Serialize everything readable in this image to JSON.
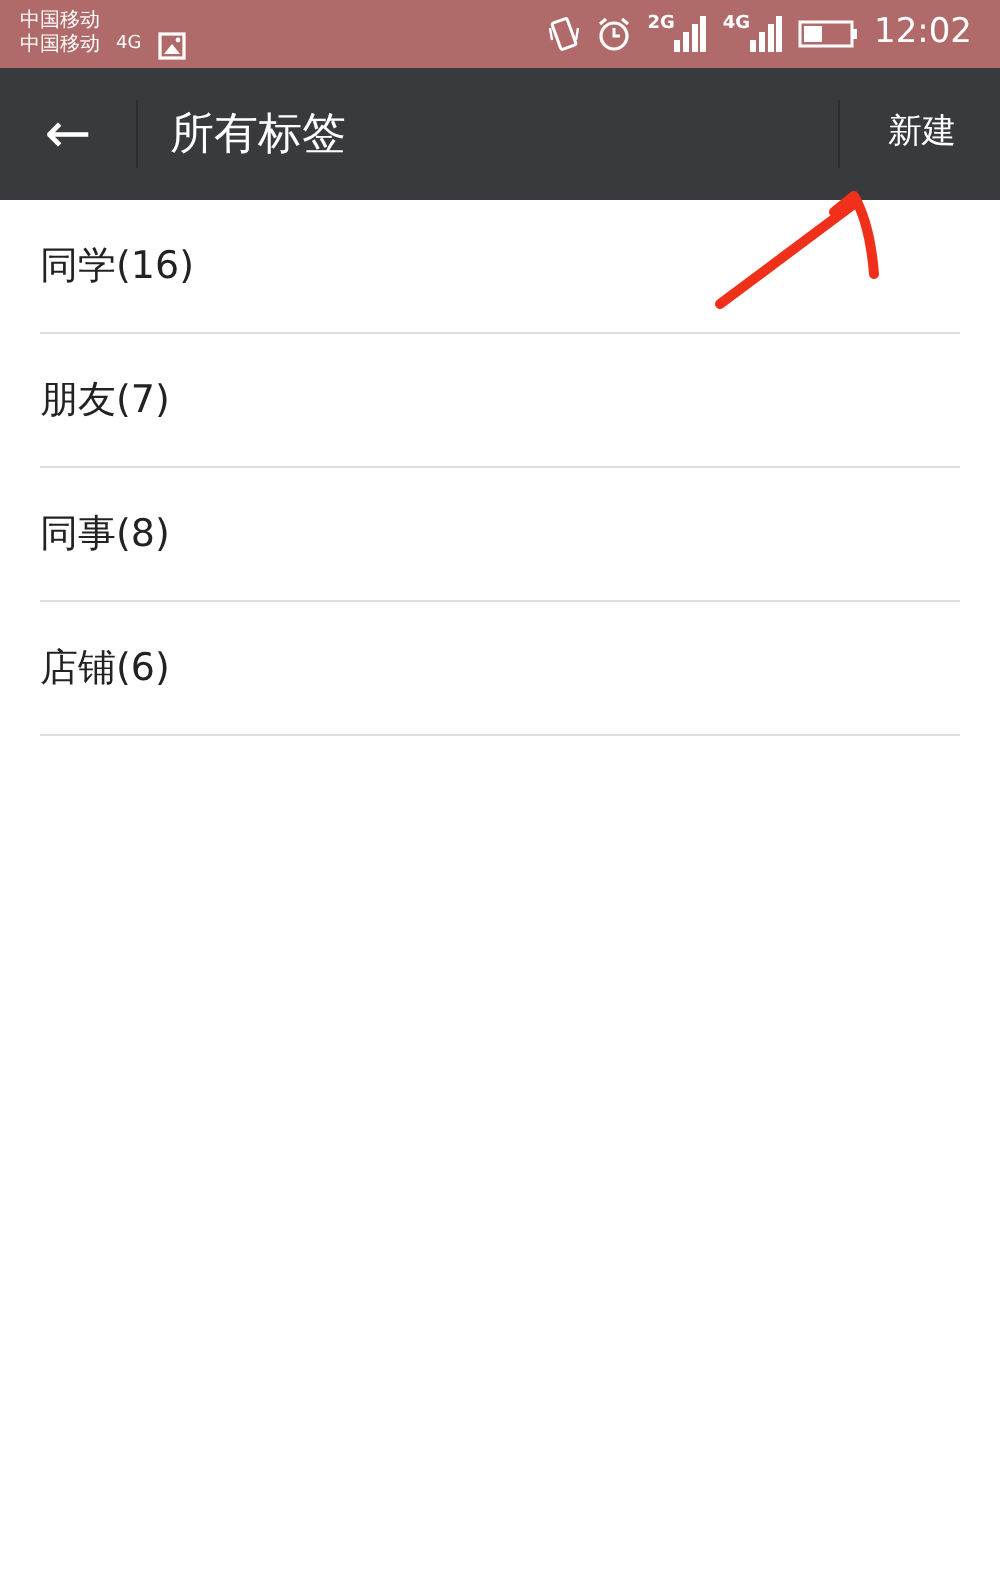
{
  "status_bar": {
    "carriers": [
      {
        "name": "中国移动"
      },
      {
        "name": "中国移动",
        "network": "4G"
      }
    ],
    "signals": [
      {
        "network": "2G"
      },
      {
        "network": "4G"
      }
    ],
    "time": "12:02"
  },
  "header": {
    "back": "←",
    "title": "所有标签",
    "action": "新建"
  },
  "tags": [
    {
      "label": "同学(16)"
    },
    {
      "label": "朋友(7)"
    },
    {
      "label": "同事(8)"
    },
    {
      "label": "店铺(6)"
    }
  ],
  "annotation": {
    "kind": "arrow"
  }
}
